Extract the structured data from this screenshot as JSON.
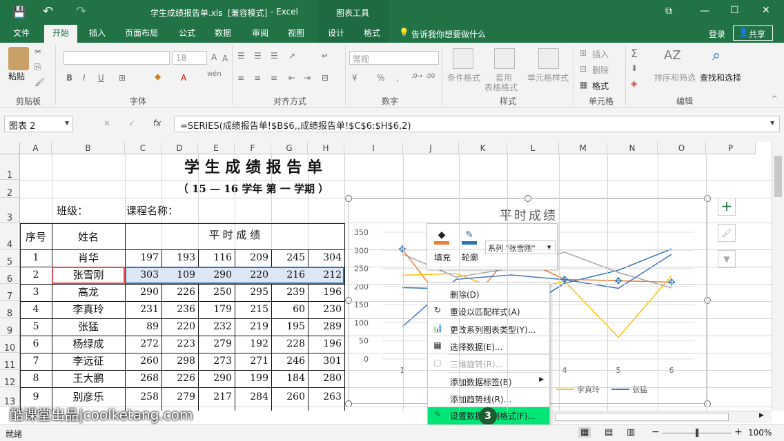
{
  "titlebar": {
    "filename": "学生成绩报告单.xls",
    "mode": "[兼容模式]",
    "app": "- Excel",
    "context_tools": "图表工具",
    "qat_save": "💾",
    "qat_undo": "↶",
    "qat_redo": "↷",
    "win_ribbon_opts": "⧉",
    "win_min": "—",
    "win_max": "☐",
    "win_close": "✕"
  },
  "tabs": [
    "文件",
    "开始",
    "插入",
    "页面布局",
    "公式",
    "数据",
    "审阅",
    "视图",
    "设计",
    "格式"
  ],
  "tell_me": "告诉我你想要做什么",
  "login": "登录",
  "share": "共享",
  "ribbon": {
    "paste": "粘贴",
    "clipboard": "剪贴板",
    "font_size": "18",
    "font": "字体",
    "bold": "B",
    "italic": "I",
    "underline": "U",
    "wen": "wén",
    "align": "对齐方式",
    "numfmt": "常规",
    "number": "数字",
    "percent": "%",
    "cond_fmt": "条件格式",
    "table_fmt": "套用",
    "table_fmt2": "表格格式",
    "cell_style": "单元格样式",
    "styles": "样式",
    "insert": "插入",
    "delete": "删除",
    "format": "格式",
    "cells": "单元格",
    "sum": "Σ",
    "sort_filter": "排序和筛选",
    "find_select": "查找和选择",
    "editing": "编辑"
  },
  "formula": {
    "namebox": "图表 2",
    "fx": "fx",
    "cancel": "✕",
    "enter": "✓",
    "text": "=SERIES(成绩报告单!$B$6,,成绩报告单!$C$6:$H$6,2)"
  },
  "columns": [
    "A",
    "B",
    "C",
    "D",
    "E",
    "F",
    "G",
    "H",
    "I",
    "J",
    "K",
    "L",
    "M",
    "N",
    "O",
    "P"
  ],
  "rows": [
    "1",
    "2",
    "3",
    "4",
    "5",
    "6",
    "7",
    "8",
    "9",
    "10",
    "11",
    "12",
    "13"
  ],
  "sheet": {
    "title": "学 生 成 绩 报 告 单",
    "subtitle": "（ 15 — 16    学年 第 一 学期 ）",
    "class_label": "班级：",
    "course_label": "课程名称：",
    "hdr_no": "序号",
    "hdr_name": "姓名",
    "hdr_scores": "平 时 成 绩",
    "data": [
      {
        "no": "1",
        "name": "肖华",
        "s": [
          "197",
          "193",
          "116",
          "209",
          "245",
          "304"
        ]
      },
      {
        "no": "2",
        "name": "张雪刚",
        "s": [
          "303",
          "109",
          "290",
          "220",
          "216",
          "212"
        ]
      },
      {
        "no": "3",
        "name": "高龙",
        "s": [
          "290",
          "226",
          "250",
          "295",
          "239",
          "196"
        ]
      },
      {
        "no": "4",
        "name": "李真玲",
        "s": [
          "231",
          "236",
          "179",
          "215",
          "60",
          "230"
        ]
      },
      {
        "no": "5",
        "name": "张猛",
        "s": [
          "89",
          "220",
          "232",
          "219",
          "195",
          "289"
        ]
      },
      {
        "no": "6",
        "name": "杨绿成",
        "s": [
          "272",
          "223",
          "279",
          "192",
          "228",
          "196"
        ]
      },
      {
        "no": "7",
        "name": "李远征",
        "s": [
          "260",
          "298",
          "273",
          "271",
          "246",
          "301"
        ]
      },
      {
        "no": "8",
        "name": "王大鹏",
        "s": [
          "268",
          "226",
          "290",
          "199",
          "184",
          "280"
        ]
      },
      {
        "no": "9",
        "name": "别彦乐",
        "s": [
          "258",
          "279",
          "217",
          "284",
          "260",
          "263"
        ]
      }
    ]
  },
  "chart_data": {
    "type": "line",
    "title": "平时成绩",
    "x": [
      1,
      2,
      3,
      4,
      5,
      6
    ],
    "ylim": [
      0,
      350
    ],
    "yticks": [
      "0",
      "50",
      "100",
      "150",
      "200",
      "250",
      "300",
      "350"
    ],
    "xticks": [
      "1",
      "4",
      "5",
      "6"
    ],
    "series": [
      {
        "name": "肖华",
        "values": [
          197,
          193,
          116,
          209,
          245,
          304
        ],
        "color": "#2e75b6"
      },
      {
        "name": "张雪刚",
        "values": [
          303,
          109,
          290,
          220,
          216,
          212
        ],
        "color": "#ed7d31"
      },
      {
        "name": "高龙",
        "values": [
          290,
          226,
          250,
          295,
          239,
          196
        ],
        "color": "#a5a5a5"
      },
      {
        "name": "李真玲",
        "values": [
          231,
          236,
          179,
          215,
          60,
          230
        ],
        "color": "#ffc000"
      },
      {
        "name": "张猛",
        "values": [
          89,
          220,
          232,
          219,
          195,
          289
        ],
        "color": "#4472c4"
      }
    ],
    "legend_visible": [
      "李真玲",
      "张猛"
    ]
  },
  "mini_toolbar": {
    "fill": "填充",
    "outline": "轮廓",
    "series_select": "系列 \"张雪刚\""
  },
  "context_menu": [
    {
      "label": "删除(D)",
      "icon": "",
      "disabled": false
    },
    {
      "label": "重设以匹配样式(A)",
      "icon": "reset-icon",
      "disabled": false
    },
    {
      "label": "更改系列图表类型(Y)...",
      "icon": "chart-type-icon",
      "disabled": false
    },
    {
      "label": "选择数据(E)...",
      "icon": "select-data-icon",
      "disabled": false
    },
    {
      "label": "三维旋转(R)...",
      "icon": "3d-rotate-icon",
      "disabled": true
    },
    {
      "label": "添加数据标签(B)",
      "icon": "",
      "disabled": false
    },
    {
      "label": "添加趋势线(R)...",
      "icon": "",
      "disabled": false
    },
    {
      "label": "设置数据系列格式(F)...",
      "icon": "format-series-icon",
      "disabled": false
    }
  ],
  "step_badge": "3",
  "watermark": "酷课堂出品|coolketang.com",
  "status": {
    "ready": "就绪",
    "zoom": "100%",
    "minus": "−",
    "plus": "+"
  },
  "colors": {
    "brand": "#217346",
    "highlight": "#00e676",
    "selected_row": "#dce6f5"
  }
}
